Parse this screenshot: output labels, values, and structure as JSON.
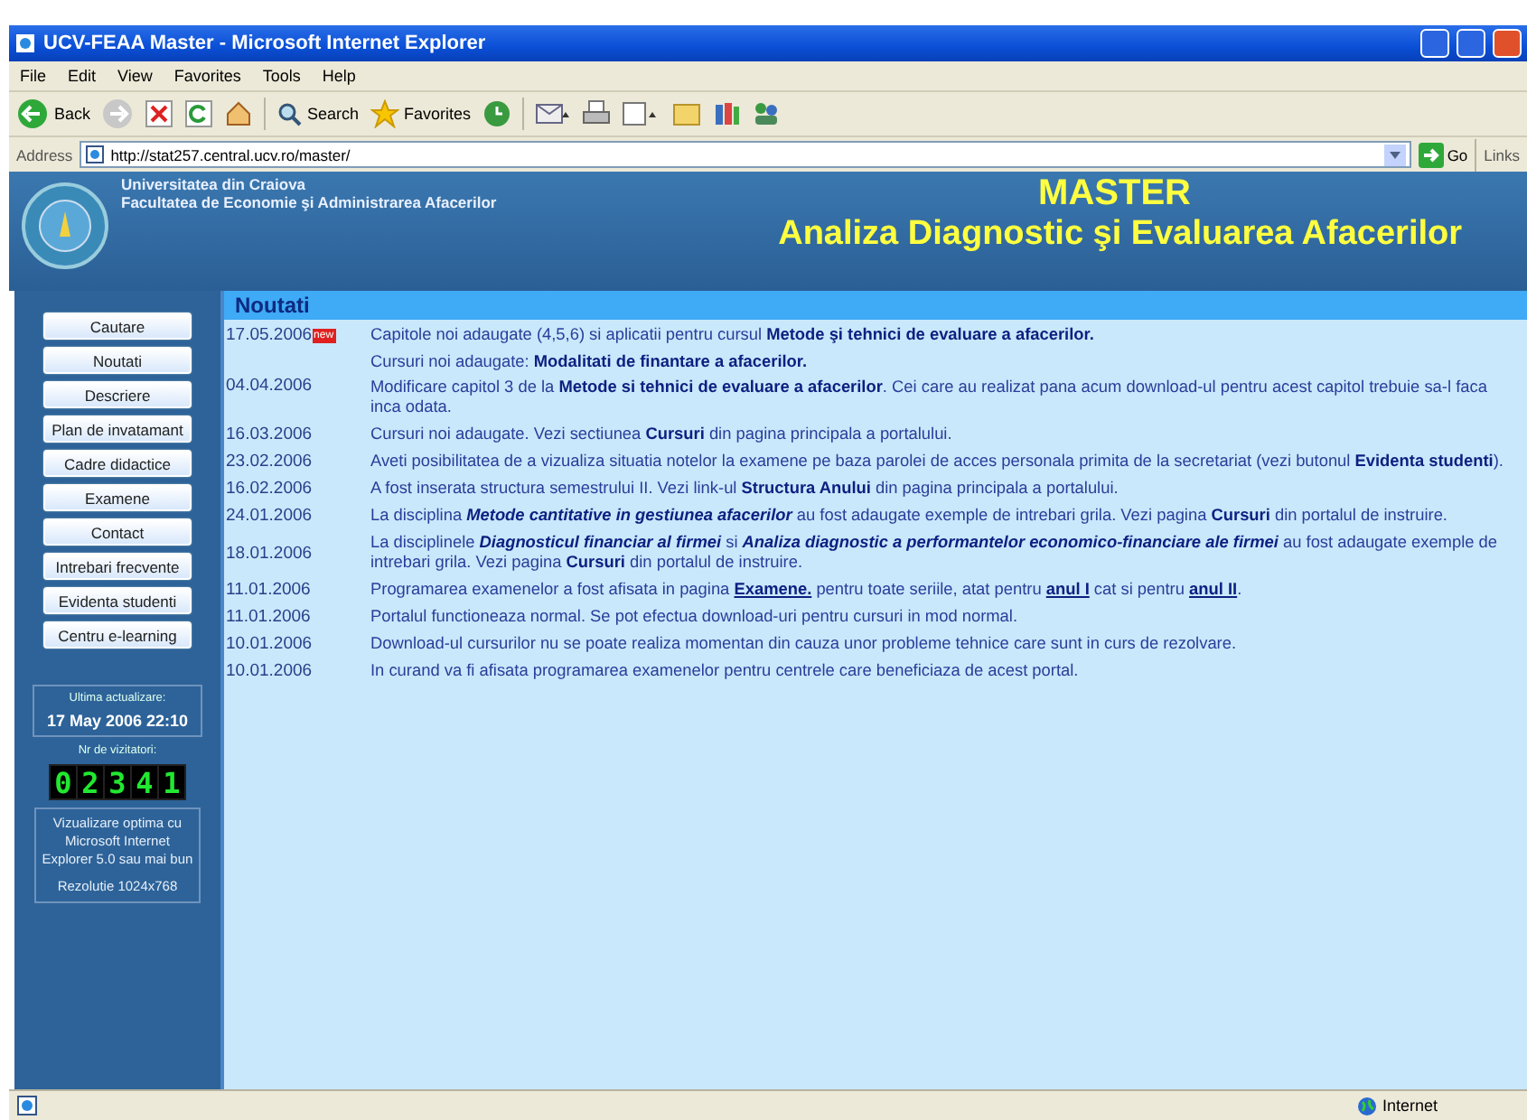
{
  "window": {
    "title": "UCV-FEAA Master - Microsoft Internet Explorer"
  },
  "menu": [
    "File",
    "Edit",
    "View",
    "Favorites",
    "Tools",
    "Help"
  ],
  "toolbar": {
    "back": "Back",
    "search": "Search",
    "favorites": "Favorites"
  },
  "address_bar": {
    "label": "Address",
    "url": "http://stat257.central.ucv.ro/master/",
    "go": "Go",
    "links": "Links"
  },
  "header": {
    "university": "Universitatea din Craiova",
    "faculty": "Facultatea de Economie şi Administrarea Afacerilor",
    "title": "MASTER",
    "subtitle": "Analiza Diagnostic şi Evaluarea Afacerilor"
  },
  "sidebar": {
    "buttons": [
      "Cautare",
      "Noutati",
      "Descriere",
      "Plan de invatamant",
      "Cadre didactice",
      "Examene",
      "Contact",
      "Intrebari frecvente",
      "Evidenta studenti",
      "Centru e-learning"
    ],
    "update_label": "Ultima actualizare:",
    "update_time": "17 May 2006 22:10",
    "visitors_label": "Nr de vizitatori:",
    "visitor_digits": [
      "0",
      "2",
      "3",
      "4",
      "1"
    ],
    "info": [
      "Vizualizare optima cu Microsoft Internet Explorer 5.0 sau mai bun",
      "Rezolutie 1024x768"
    ]
  },
  "news": {
    "heading": "Noutati",
    "items": [
      {
        "date": "17.05.2006",
        "badge": "new",
        "paragraphs": [
          [
            {
              "kind": "plain",
              "text": "Capitole noi adaugate (4,5,6) si aplicatii pentru cursul "
            },
            {
              "kind": "bold",
              "text": "Metode şi tehnici de evaluare a afacerilor."
            }
          ]
        ]
      },
      {
        "date": "04.04.2006",
        "paragraphs": [
          [
            {
              "kind": "plain",
              "text": "Cursuri noi adaugate: "
            },
            {
              "kind": "bold",
              "text": "Modalitati de finantare a afacerilor."
            }
          ],
          [
            {
              "kind": "plain",
              "text": "Modificare capitol 3 de la "
            },
            {
              "kind": "bold",
              "text": "Metode si tehnici de evaluare a afacerilor"
            },
            {
              "kind": "plain",
              "text": ". Cei care au realizat pana acum download-ul pentru acest capitol trebuie sa-l faca inca odata."
            }
          ]
        ]
      },
      {
        "date": "16.03.2006",
        "paragraphs": [
          [
            {
              "kind": "plain",
              "text": "Cursuri noi adaugate. Vezi sectiunea "
            },
            {
              "kind": "bold",
              "text": "Cursuri"
            },
            {
              "kind": "plain",
              "text": " din pagina principala a portalului."
            }
          ]
        ]
      },
      {
        "date": "23.02.2006",
        "paragraphs": [
          [
            {
              "kind": "plain",
              "text": "Aveti posibilitatea de a vizualiza situatia notelor la examene pe baza parolei de acces personala primita de la secretariat (vezi butonul "
            },
            {
              "kind": "bold",
              "text": "Evidenta studenti"
            },
            {
              "kind": "plain",
              "text": ")."
            }
          ]
        ]
      },
      {
        "date": "16.02.2006",
        "paragraphs": [
          [
            {
              "kind": "plain",
              "text": "A fost inserata structura semestrului II. Vezi link-ul "
            },
            {
              "kind": "bold",
              "text": "Structura Anului"
            },
            {
              "kind": "plain",
              "text": " din pagina principala a portalului."
            }
          ]
        ]
      },
      {
        "date": "24.01.2006",
        "paragraphs": [
          [
            {
              "kind": "plain",
              "text": "La disciplina "
            },
            {
              "kind": "bolditalic",
              "text": "Metode cantitative in gestiunea afacerilor"
            },
            {
              "kind": "plain",
              "text": "  au fost adaugate exemple de intrebari grila. Vezi pagina "
            },
            {
              "kind": "bold",
              "text": "Cursuri"
            },
            {
              "kind": "plain",
              "text": " din portalul de instruire."
            }
          ]
        ]
      },
      {
        "date": "18.01.2006",
        "paragraphs": [
          [
            {
              "kind": "plain",
              "text": "La disciplinele "
            },
            {
              "kind": "bolditalic",
              "text": "Diagnosticul financiar al firmei"
            },
            {
              "kind": "plain",
              "text": " si "
            },
            {
              "kind": "bolditalic",
              "text": "Analiza diagnostic a performantelor economico-financiare ale firmei"
            },
            {
              "kind": "plain",
              "text": "  au fost adaugate exemple de intrebari grila. Vezi pagina "
            },
            {
              "kind": "bold",
              "text": "Cursuri"
            },
            {
              "kind": "plain",
              "text": " din portalul de instruire."
            }
          ]
        ]
      },
      {
        "date": "11.01.2006",
        "paragraphs": [
          [
            {
              "kind": "plain",
              "text": "Programarea examenelor a fost afisata in pagina "
            },
            {
              "kind": "link",
              "text": "Examene."
            },
            {
              "kind": "plain",
              "text": " pentru toate seriile, atat pentru "
            },
            {
              "kind": "link",
              "text": "anul I"
            },
            {
              "kind": "plain",
              "text": " cat si pentru "
            },
            {
              "kind": "link",
              "text": "anul II"
            },
            {
              "kind": "plain",
              "text": "."
            }
          ]
        ]
      },
      {
        "date": "11.01.2006",
        "paragraphs": [
          [
            {
              "kind": "plain",
              "text": "Portalul functioneaza normal. Se pot efectua download-uri pentru cursuri in mod normal."
            }
          ]
        ]
      },
      {
        "date": "10.01.2006",
        "paragraphs": [
          [
            {
              "kind": "plain",
              "text": "Download-ul cursurilor nu se poate realiza momentan din cauza unor probleme tehnice care sunt in curs de rezolvare."
            }
          ]
        ]
      },
      {
        "date": "10.01.2006",
        "paragraphs": [
          [
            {
              "kind": "plain",
              "text": "In curand va fi afisata programarea examenelor pentru centrele care beneficiaza de acest portal."
            }
          ]
        ]
      }
    ]
  },
  "status_bar": {
    "zone": "Internet"
  }
}
